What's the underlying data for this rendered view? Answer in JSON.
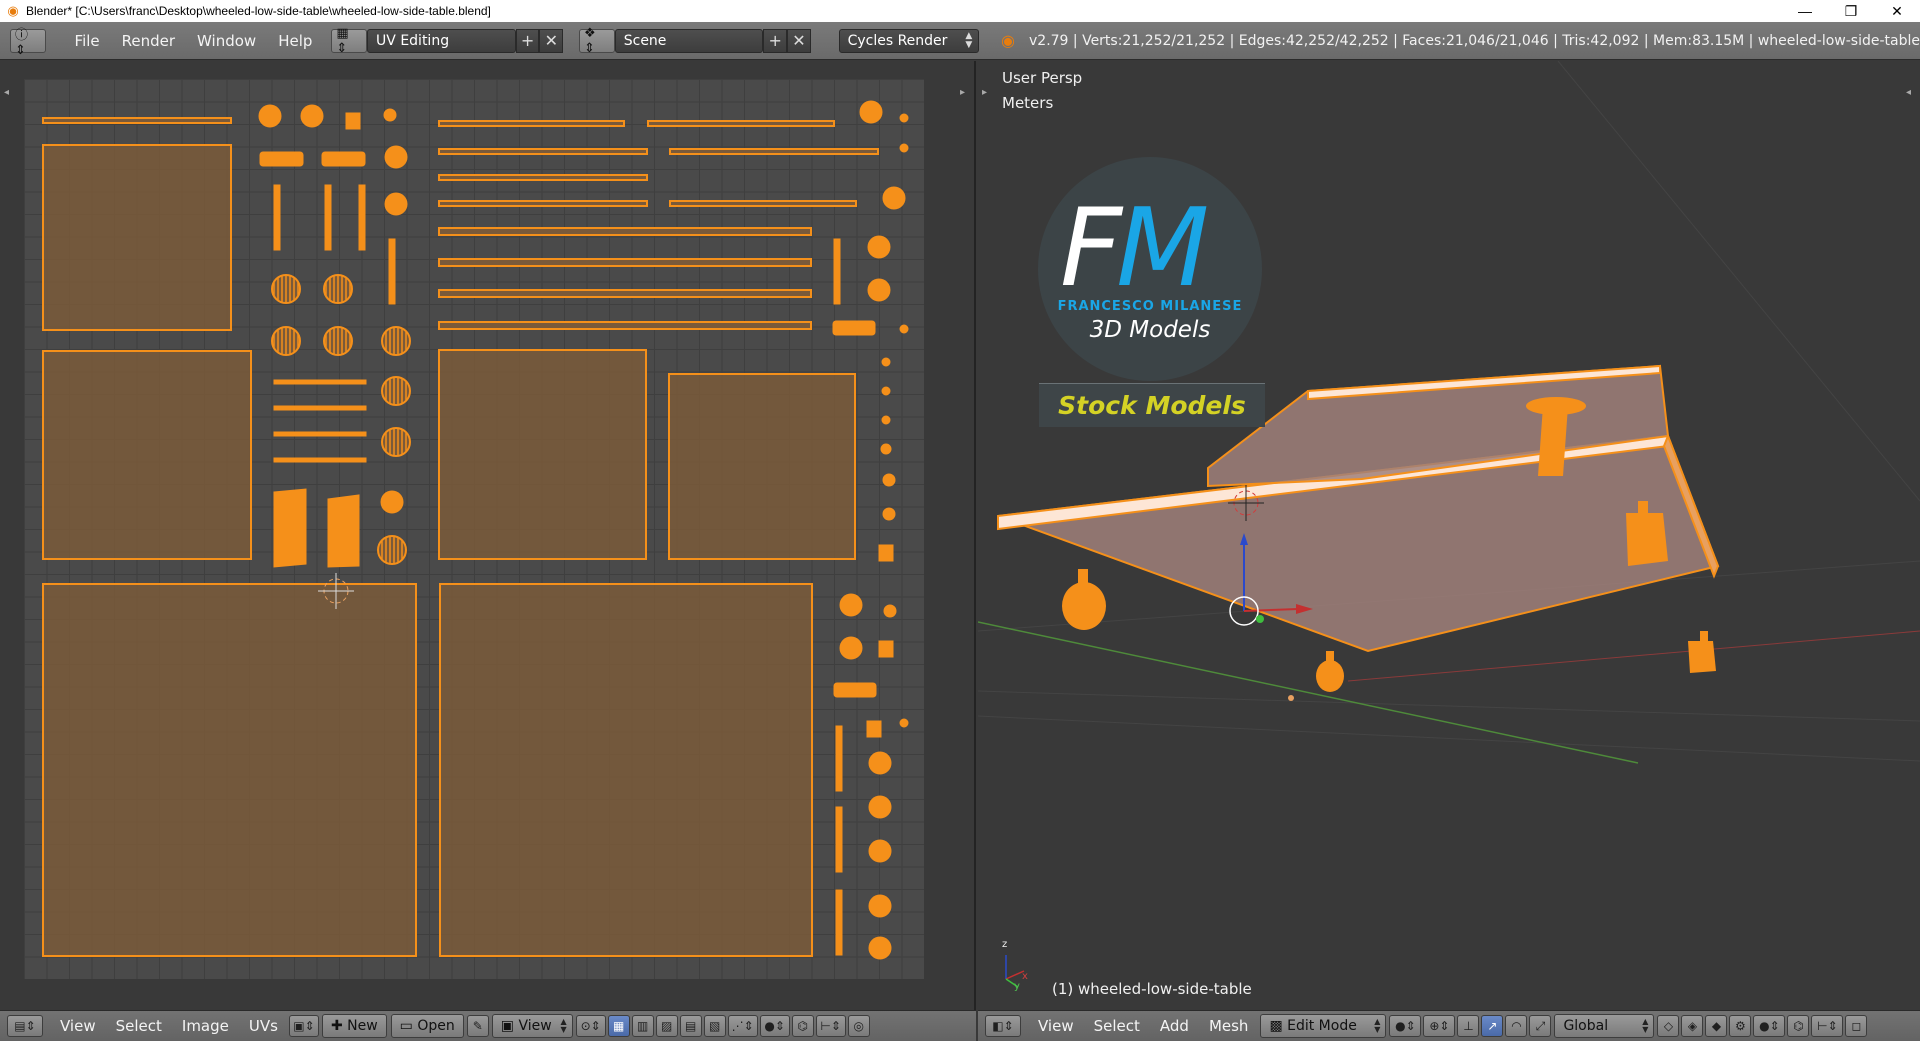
{
  "window": {
    "title": "Blender* [C:\\Users\\franc\\Desktop\\wheeled-low-side-table\\wheeled-low-side-table.blend]",
    "minimize": "—",
    "restore": "❐",
    "close": "✕"
  },
  "header": {
    "menus": [
      "File",
      "Render",
      "Window",
      "Help"
    ],
    "screen_layout": "UV Editing",
    "scene": "Scene",
    "render_engine": "Cycles Render",
    "stats": "v2.79 | Verts:21,252/21,252 | Edges:42,252/42,252 | Faces:21,046/21,046 | Tris:42,092 | Mem:83.15M | wheeled-low-side-table"
  },
  "view3d": {
    "view_label": "User Persp",
    "units_label": "Meters",
    "object_label": "(1) wheeled-low-side-table",
    "axis_x": "x",
    "axis_y": "y",
    "axis_z": "z"
  },
  "logo": {
    "fm_f": "F",
    "fm_m": "M",
    "name": "FRANCESCO MILANESE",
    "subtitle": "3D Models",
    "badge": "Stock Models"
  },
  "uv_footer": {
    "menus": [
      "View",
      "Select",
      "Image",
      "UVs"
    ],
    "new_label": "New",
    "open_label": "Open",
    "view_label": "View"
  },
  "v3d_footer": {
    "menus": [
      "View",
      "Select",
      "Add",
      "Mesh"
    ],
    "mode": "Edit Mode",
    "orientation": "Global"
  },
  "colors": {
    "uv_orange": "#f5901a",
    "uv_fill": "#7a5a3a",
    "accent_blue": "#1aa6e6",
    "badge_yellow": "#d4d225"
  }
}
